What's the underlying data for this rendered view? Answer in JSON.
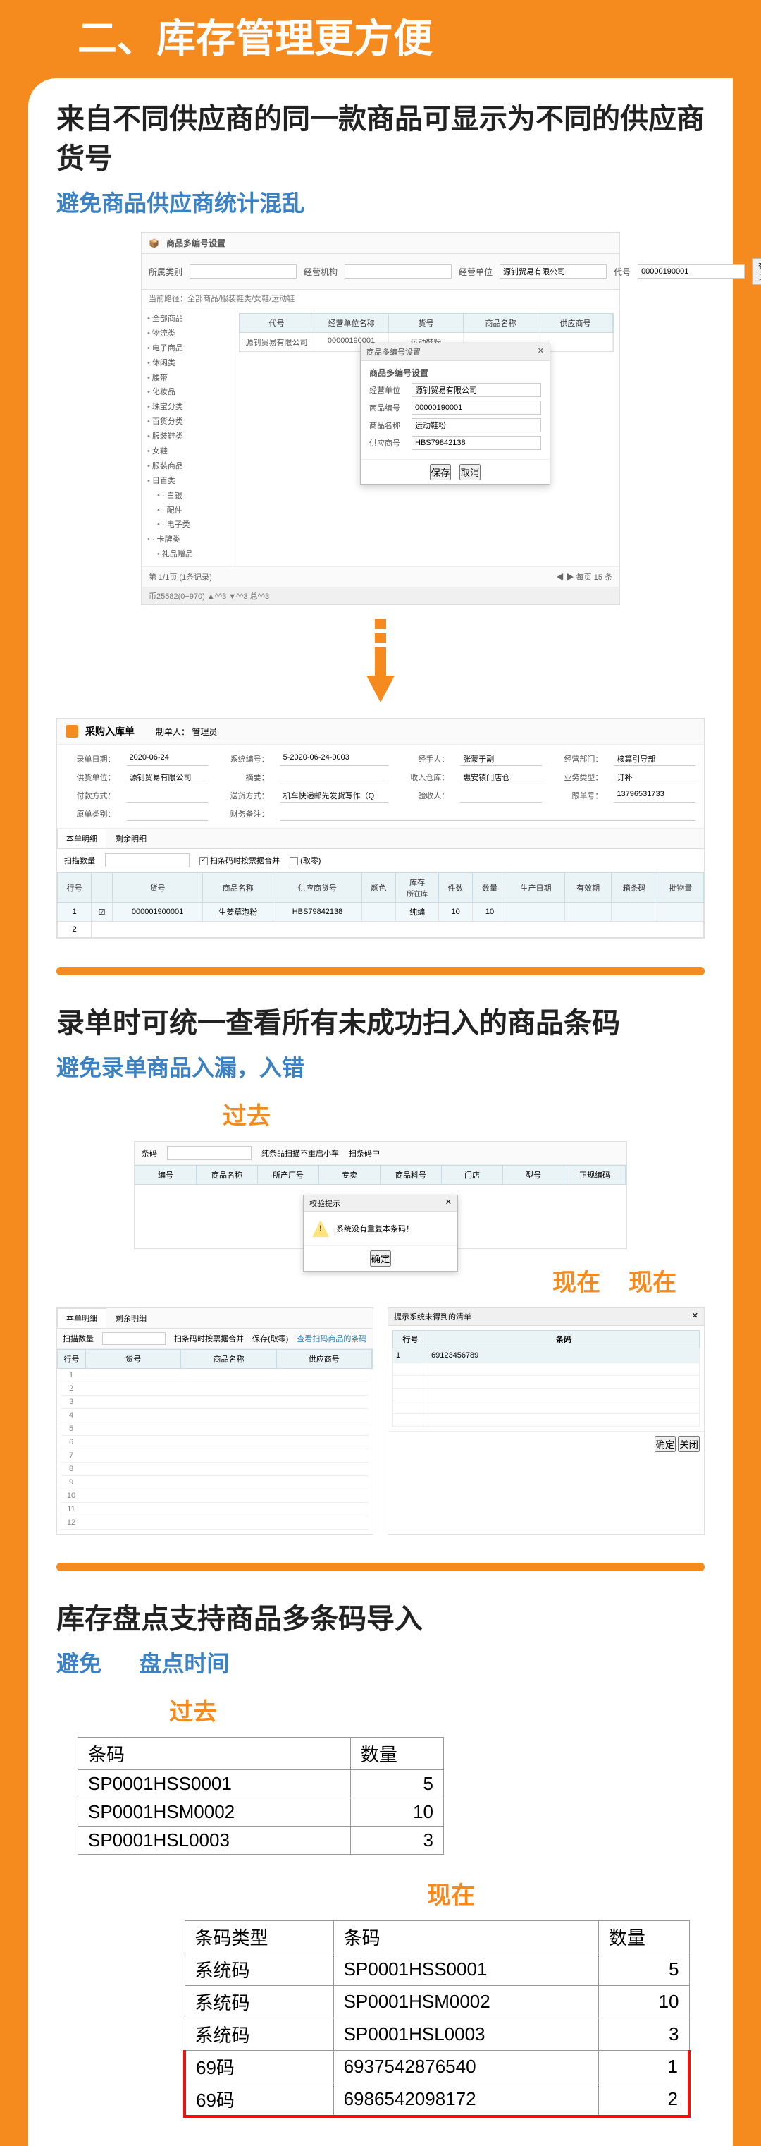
{
  "main_title": "二、库存管理更方便",
  "section1": {
    "heading": "来自不同供应商的同一款商品可显示为不同的供应商货号",
    "sub": "避免商品供应商统计混乱",
    "win1": {
      "title_icon": "📦",
      "title": "商品多编号设置",
      "toolbar": {
        "lbl_category": "所属类别",
        "val_category": "",
        "lbl_org": "经营机构",
        "val_org": "",
        "lbl_unit": "经营单位",
        "val_unit": "源钊贸易有限公司",
        "lbl_code": "代号",
        "val_code": "00000190001",
        "btn_search": "查询"
      },
      "crumb": "当前路径：全部商品/服装鞋类/女鞋/运动鞋",
      "tree": [
        "全部商品",
        "物流类",
        "电子商品",
        "休闲类",
        "腰带",
        "化妆品",
        "珠宝分类",
        "百货分类",
        "服装鞋类",
        "女鞋",
        "服装商品",
        "日百类",
        "· 白银",
        "· 配件",
        "· 电子类",
        "· 卡牌类",
        "礼品赠品"
      ],
      "grid_headers": [
        "代号",
        "经营单位名称",
        "货号",
        "商品名称",
        "供应商号"
      ],
      "grid_row": [
        "源钊贸易有限公司",
        "00000190001",
        "运动鞋粉",
        "",
        ""
      ],
      "modal": {
        "header": "商品多编号设置",
        "title": "商品多编号设置",
        "fields": {
          "lbl_unit_name": "经营单位",
          "val_unit_name": "源钊贸易有限公司",
          "lbl_prod_code": "商品编号",
          "val_prod_code": "00000190001",
          "lbl_prod_name": "商品名称",
          "val_prod_name": "运动鞋粉",
          "lbl_supp_no": "供应商号",
          "val_supp_no": "HBS79842138"
        },
        "btn_save": "保存",
        "btn_cancel": "取消"
      },
      "pager_left": "第 1/1页 (1条记录)",
      "pager_right": "◀  ▶  每页 15  条",
      "status": "币25582(0+970)  ▲^^3  ▼^^3  总^^3"
    },
    "entry": {
      "title": "采购入库单",
      "maker_lbl": "制单人：",
      "maker": "管理员",
      "fields": {
        "lbl_date": "录单日期：",
        "val_date": "2020-06-24",
        "lbl_sys_no": "系统编号：",
        "val_sys_no": "5-2020-06-24-0003",
        "lbl_handler": "经手人：",
        "val_handler": "张蒙于副",
        "lbl_dept": "经营部门：",
        "val_dept": "核算引导部",
        "lbl_supplier": "供货单位：",
        "val_supplier": "源钊贸易有限公司",
        "lbl_ref": "摘要：",
        "val_ref": "",
        "lbl_in_wh": "收入仓库：",
        "val_in_wh": "惠安镇门店仓",
        "lbl_biz_type": "业务类型：",
        "val_biz_type": "订补",
        "lbl_pay": "付款方式：",
        "val_pay": "",
        "lbl_mode": "送货方式：",
        "val_mode": "机车快递邮先发货写作（Q",
        "lbl_checker": "验收人：",
        "val_checker": "",
        "lbl_track_no": "跟单号：",
        "val_track_no": "13796531733",
        "lbl_src": "原单类别：",
        "val_src": "",
        "lbl_pay_acc": "财务备注：",
        "val_pay_acc": ""
      },
      "tabs": [
        "本单明细",
        "剩余明细"
      ],
      "tb_row": {
        "scan_lbl": "扫描数量",
        "cb1_checked": true,
        "cb1_lbl": "扫条码时按票据合并",
        "cb2_checked": false,
        "cb2_lbl": "(取零)"
      },
      "grid_headers": [
        "行号",
        "",
        "货号",
        "商品名称",
        "供应商货号",
        "颜色",
        "库存",
        "件数",
        "数量",
        "生产日期",
        "有效期",
        "箱条码",
        "批物量"
      ],
      "grid_subhead": "所在库",
      "row1": [
        "1",
        "☑",
        "000001900001",
        "生姜草泡粉",
        "HBS79842138",
        "",
        "纯编",
        "10",
        "10",
        "",
        "",
        "",
        ""
      ],
      "row2_n": "2"
    }
  },
  "section2": {
    "heading": "录单时可统一查看所有未成功扫入的商品条码",
    "sub": "避免录单商品入漏，入错",
    "past_label": "过去",
    "now_label": "现在",
    "past": {
      "tb": {
        "lbl_code": "条码",
        "cb1": "纯条品扫描不重启小车",
        "cb2": "扫条码中"
      },
      "headers": [
        "编号",
        "商品名称",
        "所产厂号",
        "专卖",
        "商品料号",
        "门店",
        "型号",
        "正规编码"
      ],
      "alert": {
        "header": "校验提示",
        "msg": "系统没有重复本条码！",
        "btn": "确定"
      }
    },
    "now_left": {
      "tabs": [
        "本单明细",
        "剩余明细"
      ],
      "tb": {
        "scan": "扫描数量",
        "cb1": "扫条码时按票据合并",
        "cb2": "保存(取零)",
        "link": "查看扫码商品的条码"
      },
      "headers": [
        "行号",
        "货号",
        "商品名称",
        "供应商号"
      ],
      "rows": [
        "1",
        "2",
        "3",
        "4",
        "5",
        "6",
        "7",
        "8",
        "9",
        "10",
        "11",
        "12"
      ]
    },
    "now_right": {
      "title": "提示系统未得到的清单",
      "headers": [
        "行号",
        "条码"
      ],
      "row1": [
        "1",
        "69123456789"
      ],
      "btn_ok": "确定",
      "btn_close": "关闭"
    }
  },
  "section3": {
    "heading": "库存盘点支持商品多条码导入",
    "sub_pre": "避免",
    "sub_post": "盘点时间",
    "past_label": "过去",
    "now_label": "现在",
    "past_table": {
      "headers": [
        "条码",
        "数量"
      ],
      "rows": [
        [
          "SP0001HSS0001",
          "5"
        ],
        [
          "SP0001HSM0002",
          "10"
        ],
        [
          "SP0001HSL0003",
          "3"
        ]
      ]
    },
    "now_table": {
      "headers": [
        "条码类型",
        "条码",
        "数量"
      ],
      "rows_sys": [
        [
          "系统码",
          "SP0001HSS0001",
          "5"
        ],
        [
          "系统码",
          "SP0001HSM0002",
          "10"
        ],
        [
          "系统码",
          "SP0001HSL0003",
          "3"
        ]
      ],
      "rows_69": [
        [
          "69码",
          "6937542876540",
          "1"
        ],
        [
          "69码",
          "6986542098172",
          "2"
        ]
      ]
    }
  }
}
